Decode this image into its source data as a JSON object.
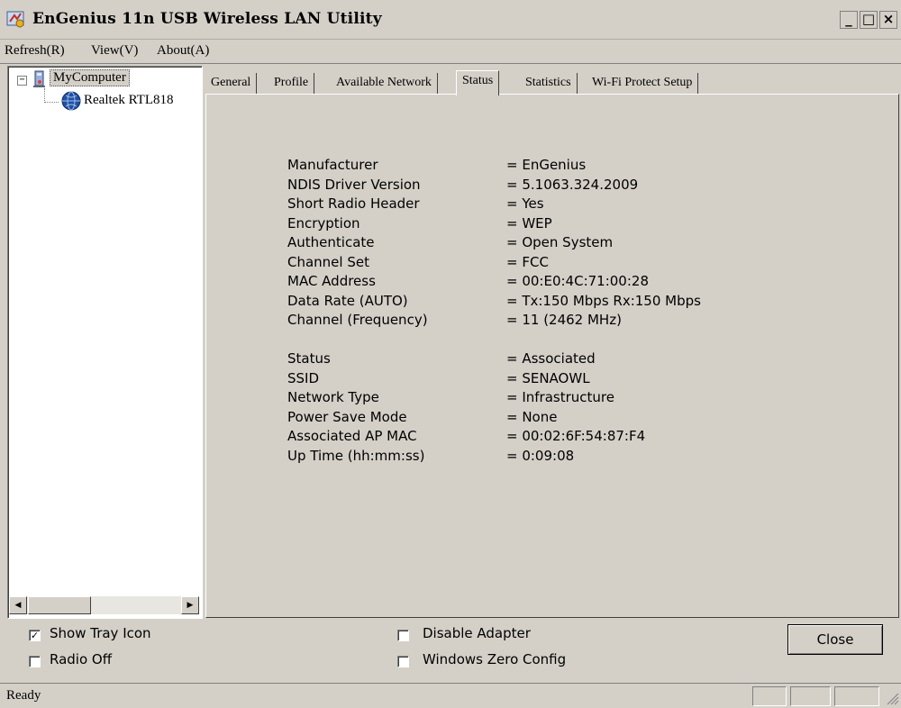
{
  "window": {
    "title": "EnGenius 11n USB Wireless LAN Utility",
    "minimize": "_",
    "maximize": "□",
    "close": "×"
  },
  "menu": [
    "Refresh(R)",
    "View(V)",
    "About(A)"
  ],
  "tree": {
    "root": "MyComputer",
    "root_expander": "−",
    "child": "Realtek RTL818"
  },
  "tabs": [
    "General",
    "Profile",
    "Available Network",
    "Status",
    "Statistics",
    "Wi-Fi Protect Setup"
  ],
  "active_tab": "Status",
  "status_info": {
    "rows1": [
      {
        "label": "Manufacturer",
        "value": "= EnGenius"
      },
      {
        "label": "NDIS Driver Version",
        "value": "= 5.1063.324.2009"
      },
      {
        "label": "Short Radio Header",
        "value": "= Yes"
      },
      {
        "label": "Encryption",
        "value": "= WEP"
      },
      {
        "label": "Authenticate",
        "value": "= Open System"
      },
      {
        "label": "Channel Set",
        "value": "= FCC"
      },
      {
        "label": "MAC Address",
        "value": "= 00:E0:4C:71:00:28"
      },
      {
        "label": "Data Rate (AUTO)",
        "value": "= Tx:150 Mbps Rx:150 Mbps"
      },
      {
        "label": "Channel (Frequency)",
        "value": "= 11 (2462 MHz)"
      }
    ],
    "rows2": [
      {
        "label": "Status",
        "value": "= Associated"
      },
      {
        "label": "SSID",
        "value": "= SENAOWL"
      },
      {
        "label": "Network Type",
        "value": "= Infrastructure"
      },
      {
        "label": "Power Save Mode",
        "value": "= None"
      },
      {
        "label": "Associated AP MAC",
        "value": "= 00:02:6F:54:87:F4"
      },
      {
        "label": "Up Time (hh:mm:ss)",
        "value": "= 0:09:08"
      }
    ]
  },
  "options": {
    "show_tray_icon": {
      "label": "Show Tray Icon",
      "checked": true,
      "mark": "✓"
    },
    "radio_off": {
      "label": "Radio Off",
      "checked": false
    },
    "disable_adapter": {
      "label": "Disable Adapter",
      "checked": false
    },
    "windows_zero_config": {
      "label": "Windows Zero Config",
      "checked": false
    }
  },
  "close_label": "Close",
  "status_bar": {
    "text": "Ready"
  }
}
